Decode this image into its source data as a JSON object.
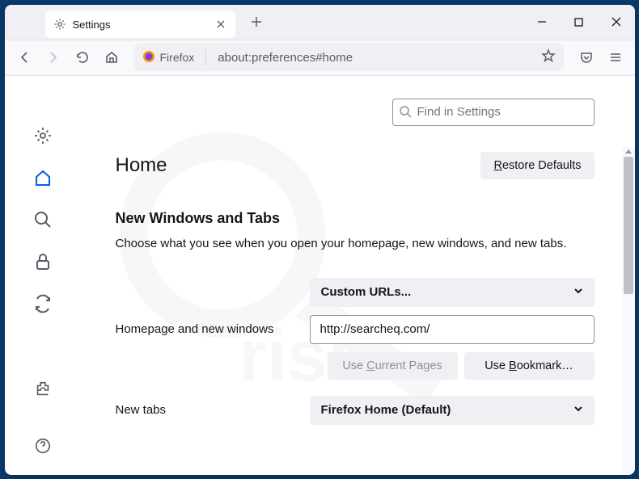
{
  "tab": {
    "title": "Settings"
  },
  "urlbar": {
    "identity": "Firefox",
    "url": "about:preferences#home"
  },
  "search": {
    "placeholder": "Find in Settings"
  },
  "page": {
    "title": "Home",
    "restore_btn": "Restore Defaults",
    "restore_u": "R"
  },
  "section": {
    "title": "New Windows and Tabs",
    "desc": "Choose what you see when you open your homepage, new windows, and new tabs."
  },
  "homepage": {
    "label": "Homepage and new windows",
    "dropdown": "Custom URLs...",
    "url_value": "http://searcheq.com/",
    "use_current": "Use Current Pages",
    "use_bookmark": "Use Bookmark…"
  },
  "newtabs": {
    "label": "New tabs",
    "dropdown": "Firefox Home (Default)"
  }
}
